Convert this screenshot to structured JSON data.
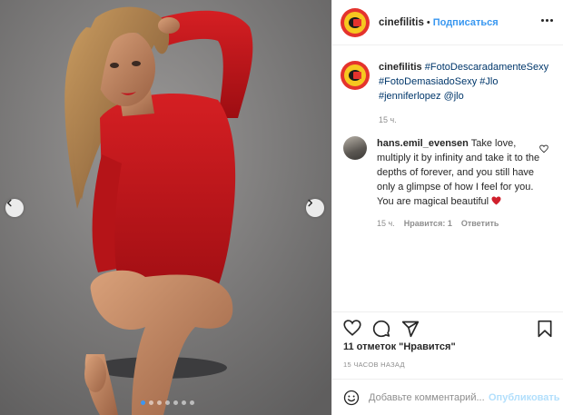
{
  "header": {
    "username": "cinefilitis",
    "separator": "•",
    "follow_label": "Подписаться"
  },
  "caption": {
    "username": "cinefilitis",
    "tags": [
      "#FotoDescaradamenteSexy",
      "#FotoDemasiadoSexy",
      "#Jlo",
      "#jenniferlopez",
      "@jlo"
    ],
    "time": "15 ч."
  },
  "comment": {
    "username": "hans.emil_evensen",
    "text": "Take love, multiply it by infinity and take it to the depths of forever, and you still have only a glimpse of how I feel for you. You are magical beautiful",
    "time": "15 ч.",
    "likes": "Нравится: 1",
    "reply": "Ответить"
  },
  "actions": {
    "likes_text": "11 отметок \"Нравится\"",
    "time_ago": "15 ЧАСОВ НАЗАД"
  },
  "composer": {
    "placeholder": "Добавьте комментарий...",
    "publish_label": "Опубликовать"
  },
  "carousel": {
    "slides": 7,
    "active_index": 0
  },
  "colors": {
    "link": "#3897f0",
    "tag": "#00376b",
    "muted": "#8e8e8e",
    "heart": "#ed4956",
    "dot_active": "#3d96f0"
  },
  "icons": [
    "chevron-left-icon",
    "chevron-right-icon",
    "more-icon",
    "heart-icon",
    "comment-icon",
    "share-icon",
    "bookmark-icon",
    "emoji-icon"
  ]
}
